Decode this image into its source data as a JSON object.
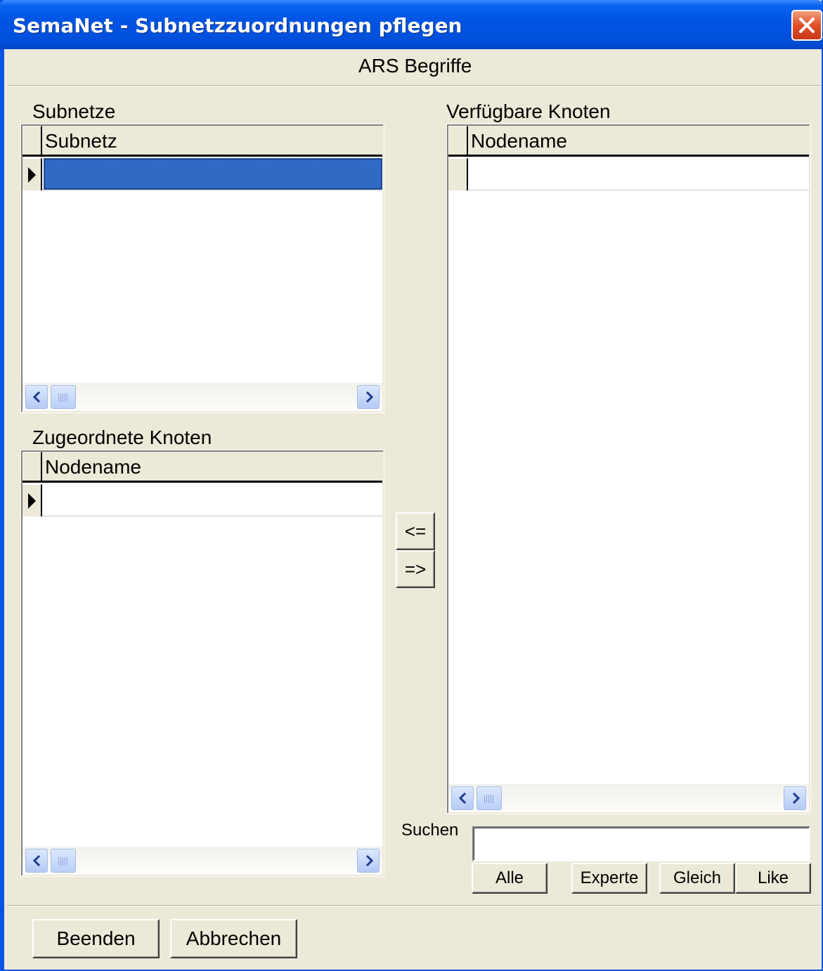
{
  "window": {
    "title": "SemaNet - Subnetzzuordnungen pflegen",
    "header": "ARS Begriffe"
  },
  "subnets": {
    "label": "Subnetze",
    "column": "Subnetz"
  },
  "assigned_nodes": {
    "label": "Zugeordnete Knoten",
    "column": "Nodename"
  },
  "available_nodes": {
    "label": "Verfügbare Knoten",
    "column": "Nodename"
  },
  "transfer": {
    "add_label": "<=",
    "remove_label": "=>"
  },
  "search": {
    "label": "Suchen",
    "value": "",
    "buttons": {
      "all": "Alle",
      "expert": "Experte",
      "equal": "Gleich",
      "like": "Like"
    }
  },
  "footer": {
    "finish": "Beenden",
    "cancel": "Abbrechen"
  },
  "colors": {
    "titlebar": "#0054e3",
    "selection": "#316ac5",
    "window_bg": "#ece9d8",
    "close": "#e0502a"
  },
  "icons": [
    "close-icon",
    "row-pointer-icon",
    "scroll-left-icon",
    "scroll-right-icon"
  ]
}
